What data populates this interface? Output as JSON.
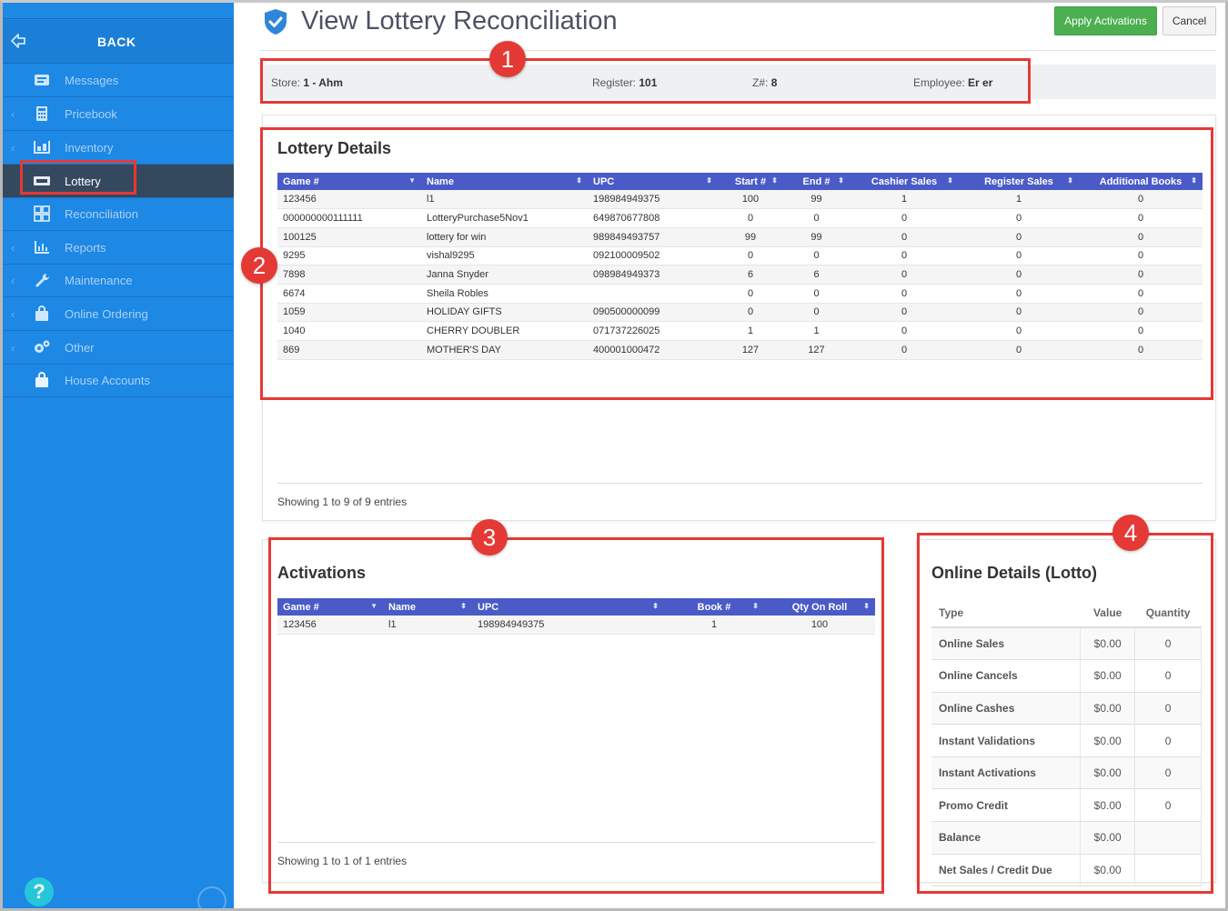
{
  "sidebar": {
    "back_label": "BACK",
    "items": [
      {
        "label": "Messages",
        "icon": "messages-icon",
        "chevron": false
      },
      {
        "label": "Pricebook",
        "icon": "calculator-icon",
        "chevron": true
      },
      {
        "label": "Inventory",
        "icon": "inventory-icon",
        "chevron": true
      },
      {
        "label": "Lottery",
        "icon": "lottery-ticket-icon",
        "chevron": false,
        "active": true
      },
      {
        "label": "Reconciliation",
        "icon": "grid-icon",
        "chevron": false
      },
      {
        "label": "Reports",
        "icon": "bar-chart-icon",
        "chevron": true
      },
      {
        "label": "Maintenance",
        "icon": "wrench-icon",
        "chevron": true
      },
      {
        "label": "Online Ordering",
        "icon": "bag-icon",
        "chevron": true
      },
      {
        "label": "Other",
        "icon": "gears-icon",
        "chevron": true
      },
      {
        "label": "House Accounts",
        "icon": "bag-icon",
        "chevron": false
      }
    ],
    "help_label": "?"
  },
  "header": {
    "title": "View Lottery Reconciliation",
    "apply_label": "Apply Activations",
    "cancel_label": "Cancel"
  },
  "info": {
    "store_label": "Store:",
    "store_value": "1 - Ahm",
    "register_label": "Register:",
    "register_value": "101",
    "z_label": "Z#:",
    "z_value": "8",
    "employee_label": "Employee:",
    "employee_value": "Er er"
  },
  "lottery": {
    "title": "Lottery Details",
    "columns": [
      "Game #",
      "Name",
      "UPC",
      "Start #",
      "End #",
      "Cashier Sales",
      "Register Sales",
      "Additional Books"
    ],
    "rows": [
      [
        "123456",
        "l1",
        "198984949375",
        "100",
        "99",
        "1",
        "1",
        "0"
      ],
      [
        "000000000111111",
        "LotteryPurchase5Nov1",
        "649870677808",
        "0",
        "0",
        "0",
        "0",
        "0"
      ],
      [
        "100125",
        "lottery for win",
        "989849493757",
        "99",
        "99",
        "0",
        "0",
        "0"
      ],
      [
        "9295",
        "vishal9295",
        "092100009502",
        "0",
        "0",
        "0",
        "0",
        "0"
      ],
      [
        "7898",
        "Janna Snyder",
        "098984949373",
        "6",
        "6",
        "0",
        "0",
        "0"
      ],
      [
        "6674",
        "Sheila Robles",
        "",
        "0",
        "0",
        "0",
        "0",
        "0"
      ],
      [
        "1059",
        "HOLIDAY GIFTS",
        "090500000099",
        "0",
        "0",
        "0",
        "0",
        "0"
      ],
      [
        "1040",
        "CHERRY DOUBLER",
        "071737226025",
        "1",
        "1",
        "0",
        "0",
        "0"
      ],
      [
        "869",
        "MOTHER'S DAY",
        "400001000472",
        "127",
        "127",
        "0",
        "0",
        "0"
      ]
    ],
    "showing": "Showing 1 to 9 of 9 entries"
  },
  "activations": {
    "title": "Activations",
    "columns": [
      "Game #",
      "Name",
      "UPC",
      "Book #",
      "Qty On Roll"
    ],
    "rows": [
      [
        "123456",
        "l1",
        "198984949375",
        "1",
        "100"
      ]
    ],
    "showing": "Showing 1 to 1 of 1 entries"
  },
  "online": {
    "title": "Online Details (Lotto)",
    "columns": [
      "Type",
      "Value",
      "Quantity"
    ],
    "rows": [
      [
        "Online Sales",
        "$0.00",
        "0"
      ],
      [
        "Online Cancels",
        "$0.00",
        "0"
      ],
      [
        "Online Cashes",
        "$0.00",
        "0"
      ],
      [
        "Instant Validations",
        "$0.00",
        "0"
      ],
      [
        "Instant Activations",
        "$0.00",
        "0"
      ],
      [
        "Promo Credit",
        "$0.00",
        "0"
      ],
      [
        "Balance",
        "$0.00",
        ""
      ],
      [
        "Net Sales / Credit Due",
        "$0.00",
        ""
      ]
    ]
  },
  "annotations": [
    "1",
    "2",
    "3",
    "4"
  ],
  "colors": {
    "sidebar": "#1e88e5",
    "sidebar_active": "#35495e",
    "table_header": "#4a5ac7",
    "apply_button": "#4caf50",
    "annotation": "#e53935"
  }
}
